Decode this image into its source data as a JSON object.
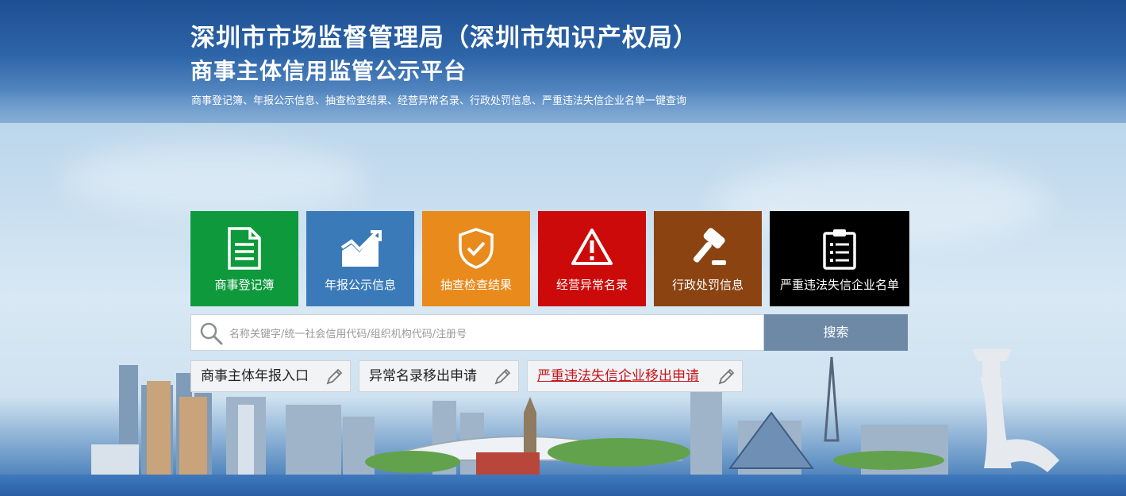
{
  "header": {
    "title": "深圳市市场监督管理局（深圳市知识产权局）",
    "platform_name": "商事主体信用监管公示平台",
    "subtitle": "商事登记簿、年报公示信息、抽查检查结果、经营异常名录、行政处罚信息、严重违法失信企业名单一键查询"
  },
  "tiles": [
    {
      "label": "商事登记簿",
      "icon": "document-icon",
      "color": "#0e9a3c"
    },
    {
      "label": "年报公示信息",
      "icon": "trend-chart-icon",
      "color": "#3b7ab8"
    },
    {
      "label": "抽查检查结果",
      "icon": "shield-check-icon",
      "color": "#e98a1d"
    },
    {
      "label": "经营异常名录",
      "icon": "warning-icon",
      "color": "#cc0a0a"
    },
    {
      "label": "行政处罚信息",
      "icon": "gavel-icon",
      "color": "#8b4311"
    },
    {
      "label": "严重违法失信企业名单",
      "icon": "clipboard-icon",
      "color": "#000000"
    }
  ],
  "search": {
    "placeholder": "名称关键字/统一社会信用代码/组织机构代码/注册号",
    "value": "",
    "button_label": "搜索"
  },
  "links": [
    {
      "label": "商事主体年报入口",
      "icon": "pencil-icon"
    },
    {
      "label": "异常名录移出申请",
      "icon": "pencil-icon"
    },
    {
      "label": "严重违法失信企业移出申请",
      "icon": "pencil-icon",
      "color": "#c4151c"
    }
  ]
}
